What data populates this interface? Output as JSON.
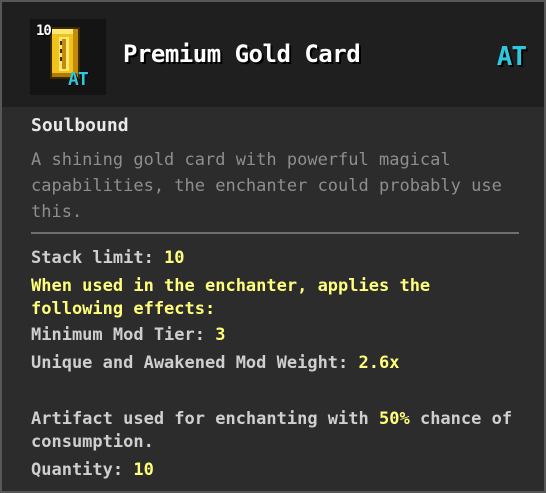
{
  "item": {
    "title": "Premium Gold Card",
    "stack_count": "10",
    "tag": "AT",
    "icon": "gold-card-icon",
    "icon_label": "AT",
    "binding": "Soulbound",
    "description": "A shining gold card with powerful magical capabilities, the enchanter could probably use this."
  },
  "stats": {
    "stack_limit_label": "Stack limit: ",
    "stack_limit_value": "10",
    "effects_header": "When used in the enchanter, applies the following effects:",
    "min_tier_label": "Minimum Mod Tier: ",
    "min_tier_value": "3",
    "weight_label": "Unique and Awakened Mod Weight: ",
    "weight_value": "2.6x",
    "artifact_pre": "Artifact used for enchanting with ",
    "artifact_chance": "50%",
    "artifact_post": " chance of consumption.",
    "quantity_label": "Quantity: ",
    "quantity_value": "10"
  },
  "colors": {
    "background": "#2c2c2c",
    "header": "#1f1f1f",
    "border": "#575757",
    "tag": "#2ec8dc",
    "highlight": "#ffff7c",
    "description": "#8e8e8e",
    "gold": "#f2c21b"
  }
}
